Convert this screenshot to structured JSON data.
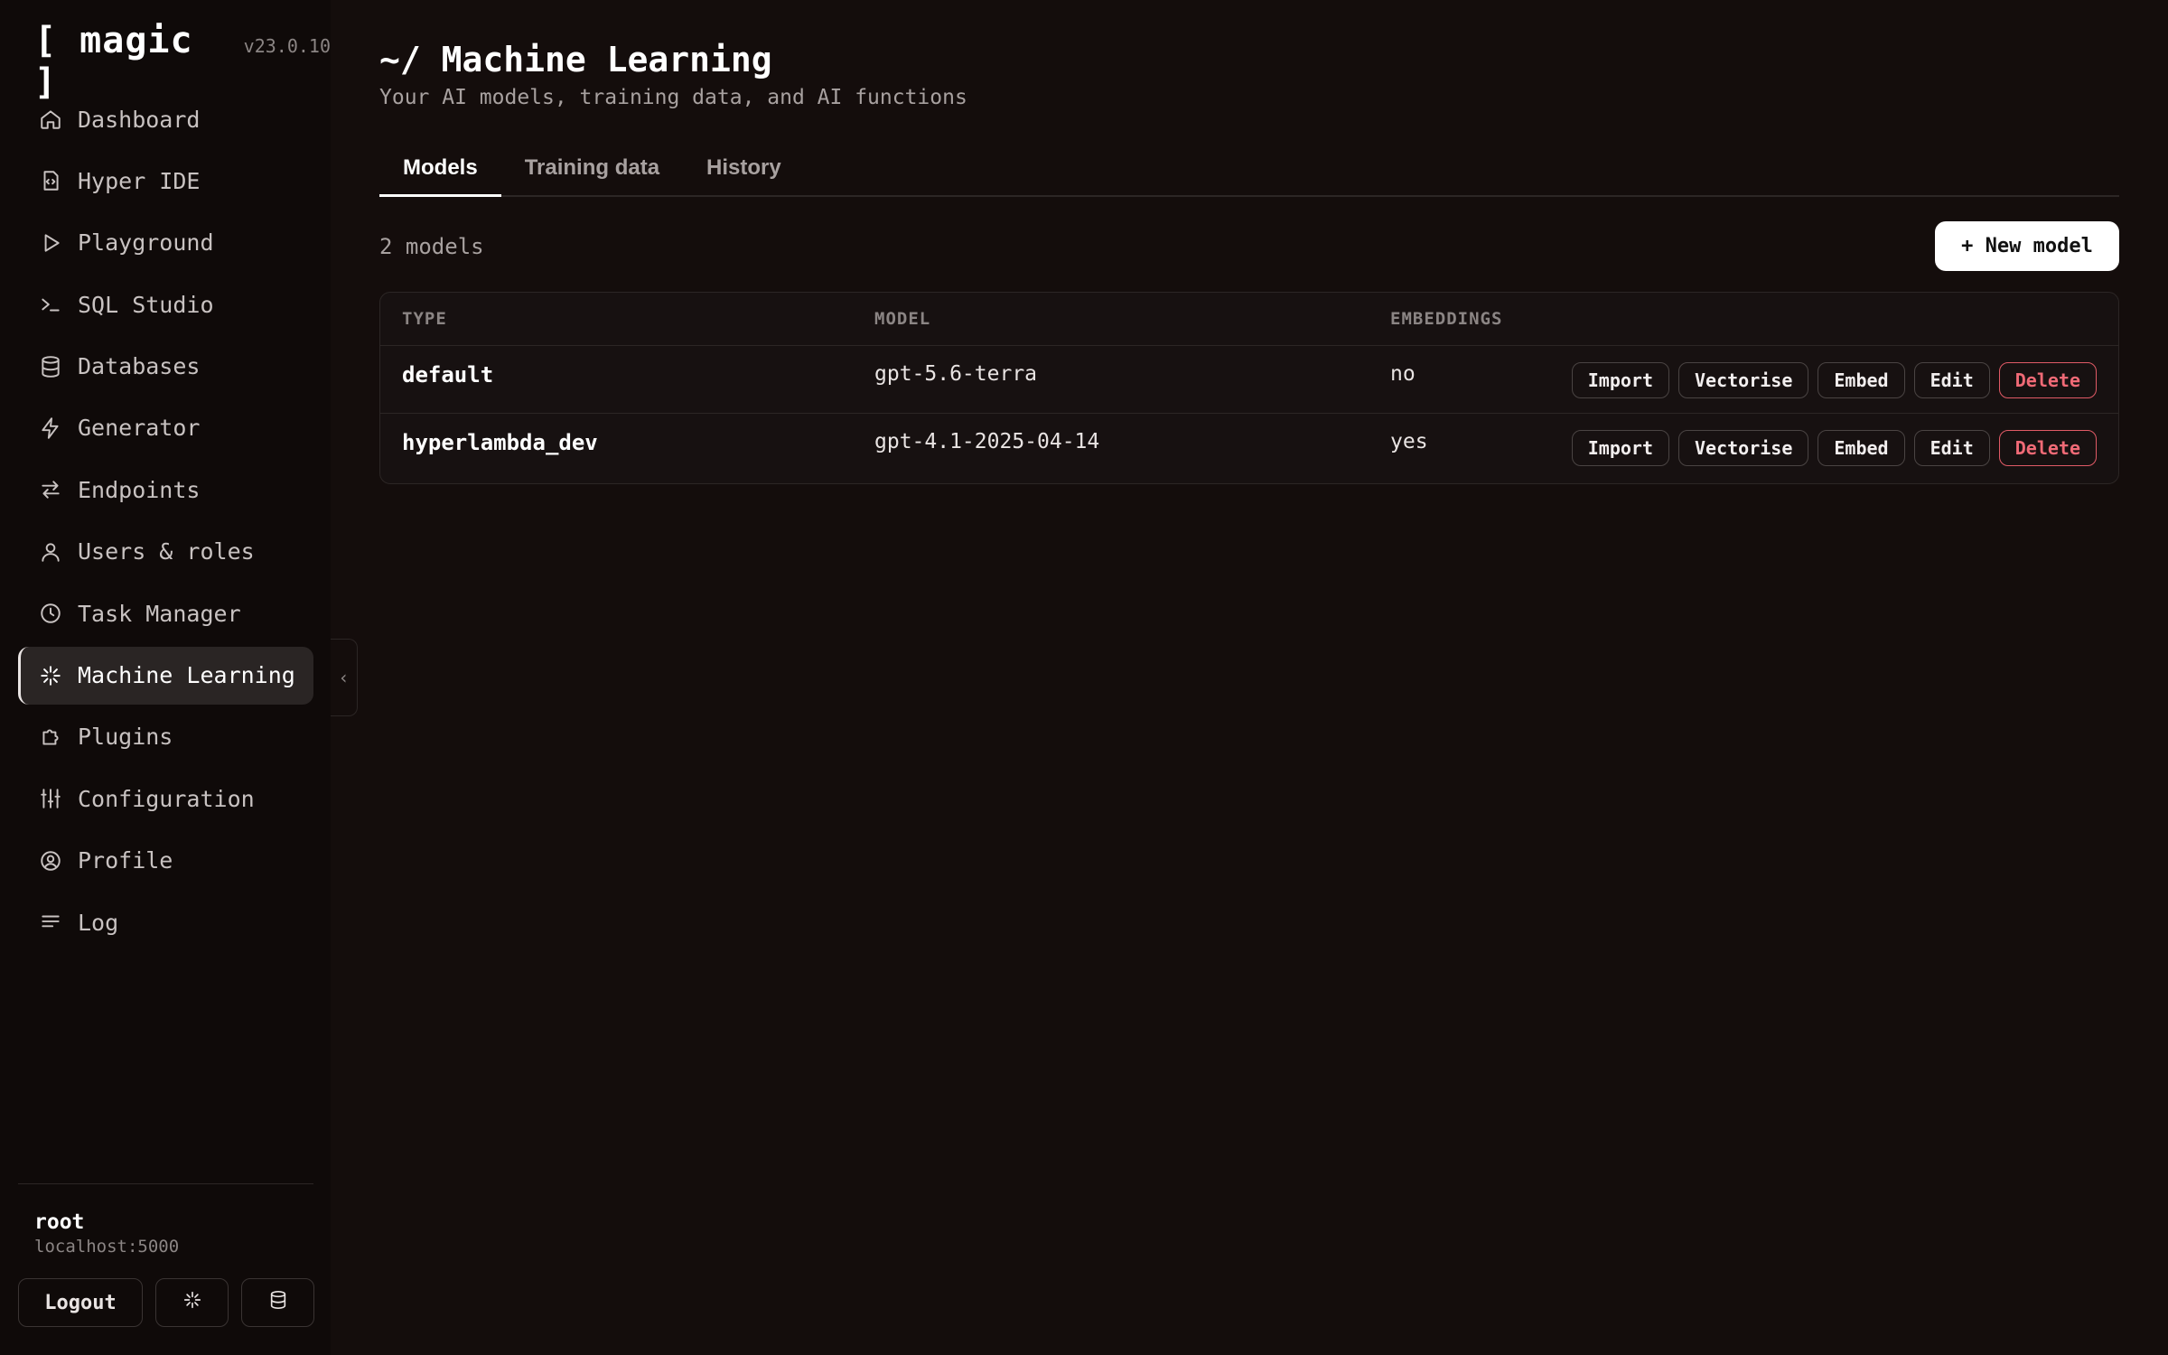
{
  "brand": {
    "logo": "[ magic ]",
    "version": "v23.0.10"
  },
  "sidebar": {
    "items": [
      {
        "label": "Dashboard",
        "icon": "home-icon"
      },
      {
        "label": "Hyper IDE",
        "icon": "code-file-icon"
      },
      {
        "label": "Playground",
        "icon": "play-icon"
      },
      {
        "label": "SQL Studio",
        "icon": "terminal-icon"
      },
      {
        "label": "Databases",
        "icon": "database-icon"
      },
      {
        "label": "Generator",
        "icon": "bolt-icon"
      },
      {
        "label": "Endpoints",
        "icon": "arrows-icon"
      },
      {
        "label": "Users & roles",
        "icon": "user-icon"
      },
      {
        "label": "Task Manager",
        "icon": "clock-icon"
      },
      {
        "label": "Machine Learning",
        "icon": "spark-icon",
        "active": true
      },
      {
        "label": "Plugins",
        "icon": "puzzle-icon"
      },
      {
        "label": "Configuration",
        "icon": "sliders-icon"
      },
      {
        "label": "Profile",
        "icon": "user-circle-icon"
      },
      {
        "label": "Log",
        "icon": "lines-icon"
      }
    ],
    "collapse_glyph": "‹",
    "user": {
      "name": "root",
      "host": "localhost:5000"
    },
    "footer": {
      "logout_label": "Logout",
      "spark_icon": "spark-icon",
      "database_icon": "database-icon"
    }
  },
  "header": {
    "title": "~/ Machine Learning",
    "subtitle": "Your AI models, training data, and AI functions"
  },
  "tabs": [
    {
      "label": "Models",
      "active": true
    },
    {
      "label": "Training data"
    },
    {
      "label": "History"
    }
  ],
  "toolbar": {
    "count_text": "2 models",
    "new_model_label": "+ New model"
  },
  "table": {
    "columns": [
      "TYPE",
      "MODEL",
      "EMBEDDINGS"
    ],
    "rows": [
      {
        "type": "default",
        "model": "gpt-5.6-terra",
        "embeddings": "no"
      },
      {
        "type": "hyperlambda_dev",
        "model": "gpt-4.1-2025-04-14",
        "embeddings": "yes"
      }
    ],
    "actions": {
      "import": "Import",
      "vectorise": "Vectorise",
      "embed": "Embed",
      "edit": "Edit",
      "delete": "Delete"
    }
  },
  "colors": {
    "background": "#140d0c",
    "sidebar": "#0f0a09",
    "danger": "#f06a76",
    "primary_button": "#ffffff"
  }
}
